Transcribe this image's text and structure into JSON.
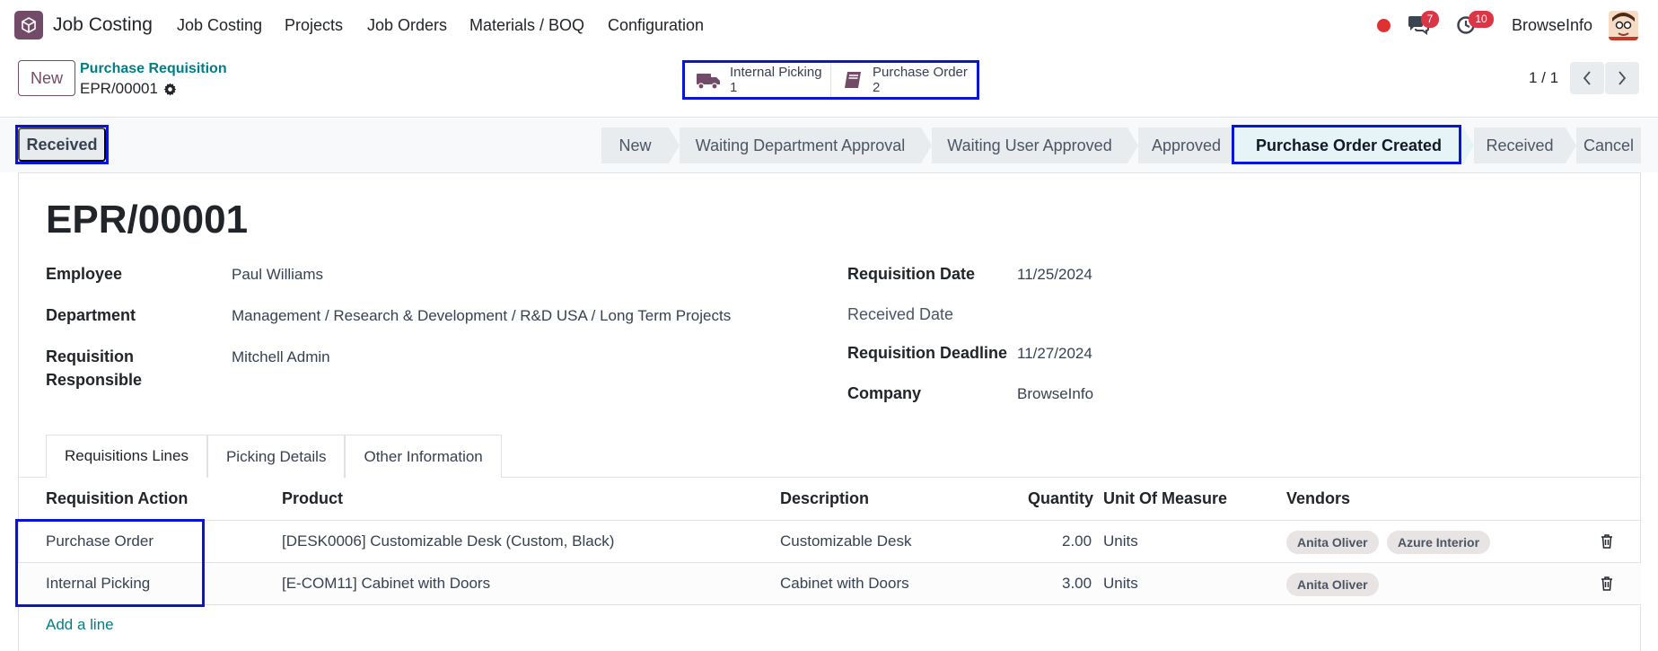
{
  "navbar": {
    "app_name": "Job Costing",
    "menu": [
      "Job Costing",
      "Projects",
      "Job Orders",
      "Materials / BOQ",
      "Configuration"
    ],
    "chat_count": "7",
    "activity_count": "10",
    "company": "BrowseInfo"
  },
  "control": {
    "new_label": "New",
    "breadcrumb_parent": "Purchase Requisition",
    "breadcrumb_current": "EPR/00001",
    "smart_buttons": [
      {
        "label": "Internal Picking",
        "count": "1",
        "icon": "truck-icon"
      },
      {
        "label": "Purchase Order",
        "count": "2",
        "icon": "book-icon"
      }
    ],
    "pager": "1 / 1"
  },
  "status": {
    "button_label": "Received",
    "stages": [
      "New",
      "Waiting Department Approval",
      "Waiting User Approved",
      "Approved",
      "Purchase Order Created",
      "Received",
      "Cancel"
    ],
    "active_stage": "Purchase Order Created"
  },
  "form": {
    "title": "EPR/00001",
    "left_fields": [
      {
        "label": "Employee",
        "value": "Paul Williams"
      },
      {
        "label": "Department",
        "value": "Management / Research & Development / R&D USA / Long Term Projects"
      },
      {
        "label": "Requisition Responsible",
        "value": "Mitchell Admin"
      }
    ],
    "right_fields": [
      {
        "label": "Requisition Date",
        "value": "11/25/2024"
      },
      {
        "label": "Received Date",
        "value": ""
      },
      {
        "label": "Requisition Deadline",
        "value": "11/27/2024"
      },
      {
        "label": "Company",
        "value": "BrowseInfo"
      }
    ]
  },
  "tabs": [
    "Requisitions Lines",
    "Picking Details",
    "Other Information"
  ],
  "table": {
    "headers": [
      "Requisition Action",
      "Product",
      "Description",
      "Quantity",
      "Unit Of Measure",
      "Vendors"
    ],
    "rows": [
      {
        "action": "Purchase Order",
        "product": "[DESK0006] Customizable Desk (Custom, Black)",
        "description": "Customizable Desk",
        "quantity": "2.00",
        "uom": "Units",
        "vendors": [
          "Anita Oliver",
          "Azure Interior"
        ]
      },
      {
        "action": "Internal Picking",
        "product": "[E-COM11] Cabinet with Doors",
        "description": "Cabinet with Doors",
        "quantity": "3.00",
        "uom": "Units",
        "vendors": [
          "Anita Oliver"
        ]
      }
    ],
    "add_line": "Add a line"
  },
  "colors": {
    "brand": "#714b67",
    "link": "#017e84",
    "highlight": "#0a14d6",
    "badge": "#dc3545"
  }
}
